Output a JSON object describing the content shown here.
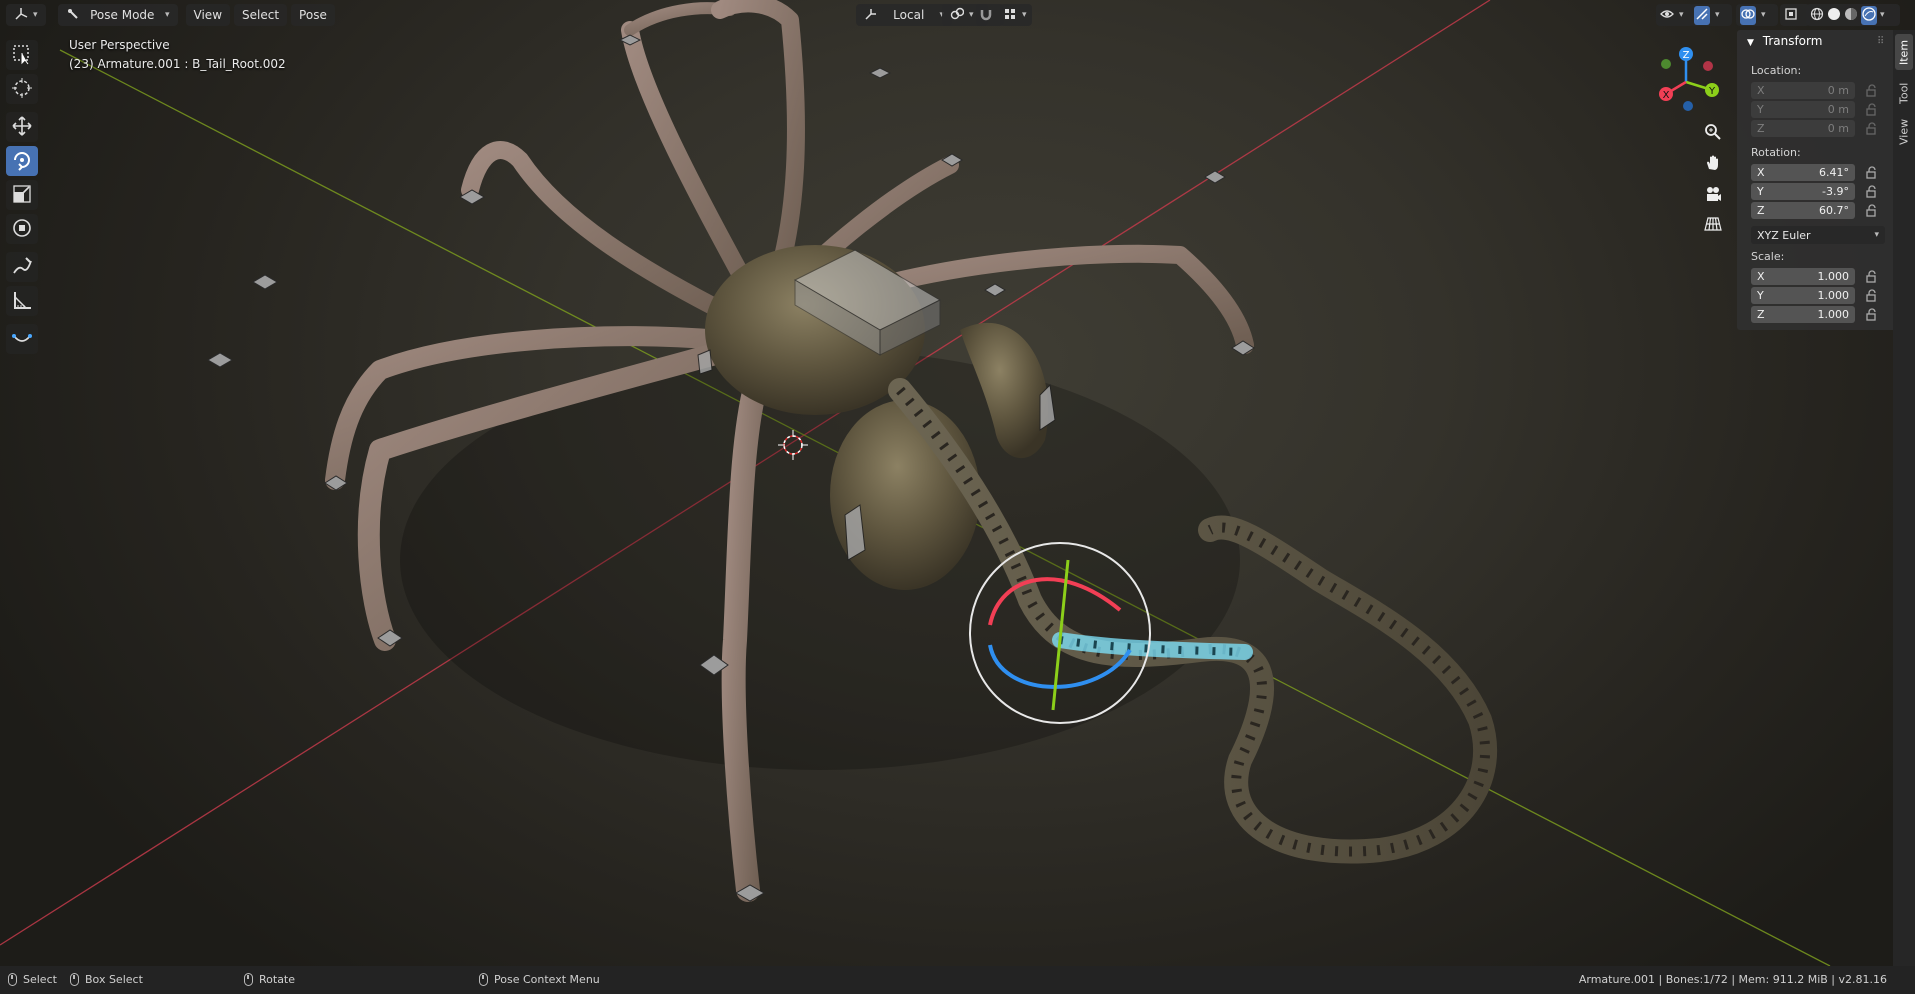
{
  "header": {
    "editor_type_icon": "axes-3d-icon",
    "mode_label": "Pose Mode",
    "menus": [
      "View",
      "Select",
      "Pose"
    ],
    "transform_orientation": "Local"
  },
  "viewport": {
    "perspective_label": "User Perspective",
    "object_info": "(23) Armature.001 : B_Tail_Root.002"
  },
  "toolbar": {
    "tools": [
      {
        "name": "select-box-tool",
        "icon": "select-box-icon",
        "active": false
      },
      {
        "name": "cursor-tool",
        "icon": "cursor-icon",
        "active": false
      },
      {
        "name": "move-tool",
        "icon": "move-icon",
        "active": false
      },
      {
        "name": "rotate-tool",
        "icon": "rotate-icon",
        "active": true
      },
      {
        "name": "scale-tool",
        "icon": "scale-icon",
        "active": false
      },
      {
        "name": "transform-tool",
        "icon": "transform-icon",
        "active": false
      },
      {
        "name": "annotate-tool",
        "icon": "annotate-icon",
        "active": false
      },
      {
        "name": "measure-tool",
        "icon": "measure-icon",
        "active": false
      },
      {
        "name": "bone-tool",
        "icon": "bone-icon",
        "active": false
      }
    ]
  },
  "gizmo": {
    "axes": [
      "X",
      "Y",
      "Z"
    ],
    "colors": {
      "x": "#f23f55",
      "y": "#8ccf1a",
      "z": "#2f8ff0"
    }
  },
  "sidebar": {
    "tabs": [
      "Item",
      "Tool",
      "View"
    ],
    "panel_title": "Transform",
    "location": {
      "label": "Location:",
      "x": {
        "axis": "X",
        "value": "0 m"
      },
      "y": {
        "axis": "Y",
        "value": "0 m"
      },
      "z": {
        "axis": "Z",
        "value": "0 m"
      }
    },
    "rotation": {
      "label": "Rotation:",
      "x": {
        "axis": "X",
        "value": "6.41°"
      },
      "y": {
        "axis": "Y",
        "value": "-3.9°"
      },
      "z": {
        "axis": "Z",
        "value": "60.7°"
      },
      "mode": "XYZ Euler"
    },
    "scale": {
      "label": "Scale:",
      "x": {
        "axis": "X",
        "value": "1.000"
      },
      "y": {
        "axis": "Y",
        "value": "1.000"
      },
      "z": {
        "axis": "Z",
        "value": "1.000"
      }
    }
  },
  "statusbar": {
    "select": "Select",
    "box_select": "Box Select",
    "rotate": "Rotate",
    "context_menu": "Pose Context Menu",
    "stats": "Armature.001 | Bones:1/72 | Mem: 911.2 MiB | v2.81.16"
  },
  "colors": {
    "accent": "#4772b3",
    "x_axis_line": "#c23a4a",
    "y_axis_line": "#7a9a1e",
    "selected_bone": "#7fe6ff"
  }
}
